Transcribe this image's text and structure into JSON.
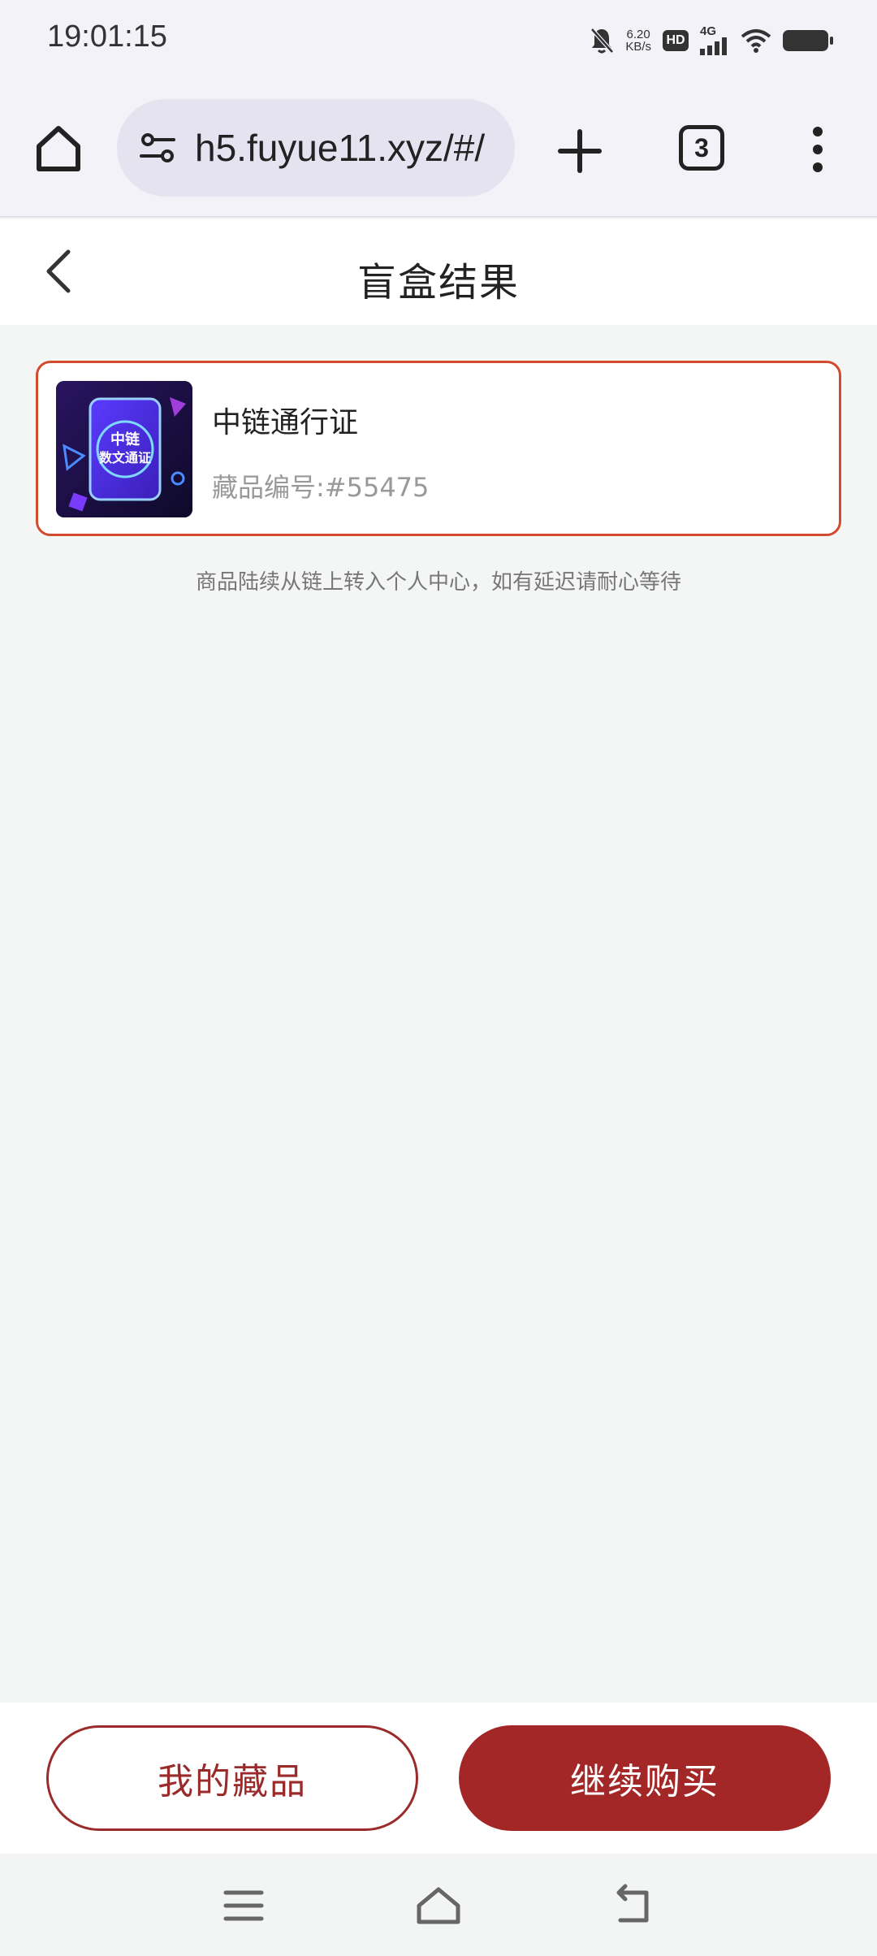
{
  "status_bar": {
    "time": "19:01:15",
    "speed_value": "6.20",
    "speed_unit": "KB/s",
    "hd_label": "HD",
    "network_label": "4G",
    "icons": [
      "mute-bell-icon",
      "signal-icon",
      "wifi-icon",
      "battery-icon"
    ]
  },
  "browser": {
    "url": "h5.fuyue11.xyz/#/",
    "tab_count": "3",
    "icons": [
      "home-icon",
      "site-settings-icon",
      "plus-icon",
      "more-vert-icon"
    ]
  },
  "header": {
    "title": "盲盒结果"
  },
  "result": {
    "item_name": "中链通行证",
    "item_code": "藏品编号:#55475",
    "thumb_text_line1": "中链",
    "thumb_text_line2": "数文通证"
  },
  "notice": "商品陆续从链上转入个人中心，如有延迟请耐心等待",
  "actions": {
    "my_collection": "我的藏品",
    "continue_buy": "继续购买"
  },
  "colors": {
    "accent": "#a32727",
    "card_border": "#d34a2e",
    "background": "#f4f5f5"
  },
  "nav": {
    "icons": [
      "menu-icon",
      "home-icon",
      "back-icon"
    ]
  }
}
